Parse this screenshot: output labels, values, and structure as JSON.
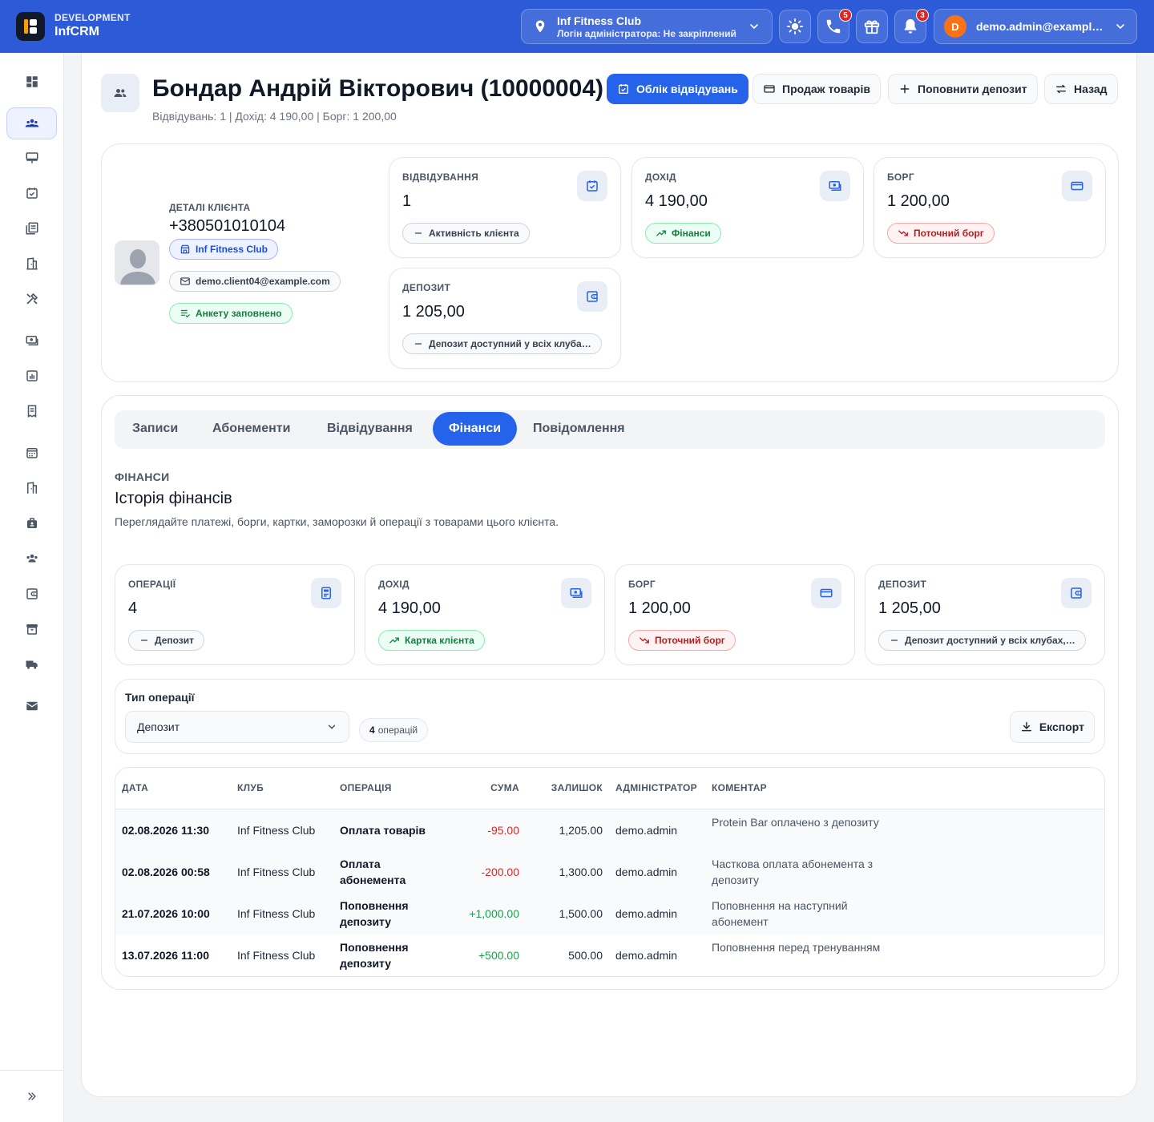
{
  "topbar": {
    "env": "DEVELOPMENT",
    "app_name": "InfCRM",
    "club_name": "Inf Fitness Club",
    "club_sub": "Логін адміністратора: Не закріплений",
    "phone_badge": "5",
    "notif_badge": "3",
    "user_initial": "D",
    "user_email": "demo.admin@example.com"
  },
  "sidebar": {
    "items": [
      "dashboard-icon",
      "clients-icon",
      "desk-icon",
      "calendar-check-icon",
      "catalog-icon",
      "building-icon",
      "tools-icon",
      "cash-icon",
      "report-icon",
      "receipt-icon",
      "schedule-icon",
      "rooms-icon",
      "staff-icon",
      "team-icon",
      "wallet-icon",
      "archive-icon",
      "truck-icon",
      "mail-icon"
    ]
  },
  "header": {
    "title": "Бондар Андрій Вікторович (10000004)",
    "subtitle": "Відвідувань: 1 | Дохід: 4 190,00 | Борг: 1 200,00",
    "btn_attendance": "Облік відвідувань",
    "btn_sell": "Продаж товарів",
    "btn_deposit": "Поповнити депозит",
    "btn_back": "Назад"
  },
  "client": {
    "details_label": "ДЕТАЛІ КЛІЄНТА",
    "phone": "+380501010104",
    "club": "Inf Fitness Club",
    "email": "demo.client04@example.com",
    "form": "Анкету заповнено"
  },
  "stats": {
    "visits_label": "ВІДВІДУВАННЯ",
    "visits_value": "1",
    "visits_chip": "Активність клієнта",
    "income_label": "ДОХІД",
    "income_value": "4 190,00",
    "income_chip": "Фінанси",
    "debt_label": "БОРГ",
    "debt_value": "1 200,00",
    "debt_chip": "Поточний борг",
    "deposit_label": "ДЕПОЗИТ",
    "deposit_value": "1 205,00",
    "deposit_chip": "Депозит доступний у всіх клуба…"
  },
  "tabs": [
    "Записи",
    "Абонементи",
    "Відвідування",
    "Фінанси",
    "Повідомлення"
  ],
  "finance": {
    "section_label": "ФІНАНСИ",
    "title": "Історія фінансів",
    "description": "Переглядайте платежі, борги, картки, заморозки й операції з товарами цього клієнта.",
    "ops_label": "ОПЕРАЦІЇ",
    "ops_value": "4",
    "ops_chip": "Депозит",
    "income_label": "ДОХІД",
    "income_value": "4 190,00",
    "income_chip": "Картка клієнта",
    "debt_label": "БОРГ",
    "debt_value": "1 200,00",
    "debt_chip": "Поточний борг",
    "deposit_label": "ДЕПОЗИТ",
    "deposit_value": "1 205,00",
    "deposit_chip": "Депозит доступний у всіх клубах,…"
  },
  "filter": {
    "label": "Тип операції",
    "selected": "Депозит",
    "count_num": "4",
    "count_text": "операцій",
    "export": "Експорт"
  },
  "table": {
    "columns": [
      "ДАТА",
      "КЛУБ",
      "ОПЕРАЦІЯ",
      "СУМА",
      "ЗАЛИШОК",
      "АДМІНІСТРАТОР",
      "КОМЕНТАР"
    ],
    "rows": [
      {
        "date": "02.08.2026 11:30",
        "club": "Inf Fitness Club",
        "op": "Оплата товарів",
        "sum": "-95.00",
        "balance": "1,205.00",
        "admin": "demo.admin",
        "comment": "Protein Bar оплачено з депозиту"
      },
      {
        "date": "02.08.2026 00:58",
        "club": "Inf Fitness Club",
        "op": "Оплата абонемента",
        "sum": "-200.00",
        "balance": "1,300.00",
        "admin": "demo.admin",
        "comment": "Часткова оплата абонемента з депозиту"
      },
      {
        "date": "21.07.2026 10:00",
        "club": "Inf Fitness Club",
        "op": "Поповнення депозиту",
        "sum": "+1,000.00",
        "balance": "1,500.00",
        "admin": "demo.admin",
        "comment": "Поповнення на наступний абонемент"
      },
      {
        "date": "13.07.2026 11:00",
        "club": "Inf Fitness Club",
        "op": "Поповнення депозиту",
        "sum": "+500.00",
        "balance": "500.00",
        "admin": "demo.admin",
        "comment": "Поповнення перед тренуванням"
      }
    ]
  },
  "colors": {
    "primary": "#2563eb",
    "topbar": "#2d5bd7",
    "negative": "#dc2626",
    "positive": "#16a34a"
  }
}
